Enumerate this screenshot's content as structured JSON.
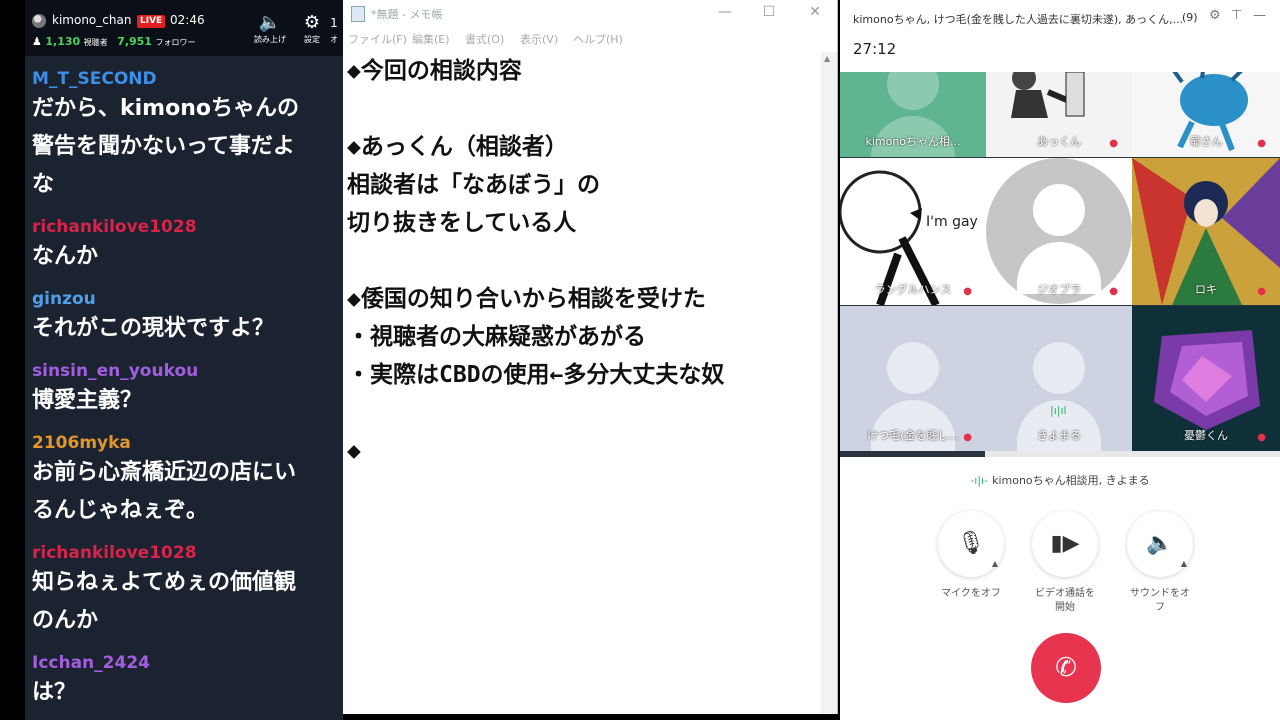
{
  "chat": {
    "header": {
      "username": "kimono_chan",
      "live_badge": "LIVE",
      "elapsed": "02:46",
      "viewers": "1,130",
      "viewers_label": "視聴者",
      "followers": "7,951",
      "followers_label": "フォロワー",
      "readaloud_label": "読み上げ",
      "settings_label": "設定",
      "extra_label": "オ"
    },
    "messages": [
      {
        "user": "M_T_SECOND",
        "color": "#3d8fe6",
        "lines": [
          "だから、kimonoちゃんの",
          "警告を聞かないって事だよ",
          "な"
        ]
      },
      {
        "user": "richankilove1028",
        "color": "#d8234a",
        "lines": [
          "なんか"
        ]
      },
      {
        "user": "ginzou",
        "color": "#4ea0e8",
        "lines": [
          "それがこの現状ですよ？"
        ]
      },
      {
        "user": "sinsin_en_youkou",
        "color": "#a35ee0",
        "lines": [
          "博愛主義？"
        ]
      },
      {
        "user": "2106myka",
        "color": "#e0962a",
        "lines": [
          "お前ら心斎橋近辺の店にい",
          "るんじゃねぇぞ。"
        ]
      },
      {
        "user": "richankilove1028",
        "color": "#d8234a",
        "lines": [
          "知らねぇよてめぇの価値観",
          "のんか"
        ]
      },
      {
        "user": "Icchan_2424",
        "color": "#a35ee0",
        "lines": [
          "は？"
        ]
      }
    ]
  },
  "notepad": {
    "title": "*無題 - メモ帳",
    "menu": [
      "ファイル(F)",
      "編集(E)",
      "書式(O)",
      "表示(V)",
      "ヘルプ(H)"
    ],
    "lines": [
      "◆今回の相談内容",
      "",
      "◆あっくん（相談者）",
      "相談者は「なあぼう」の",
      "切り抜きをしている人",
      "",
      "◆倭国の知り合いから相談を受けた",
      "・視聴者の大麻疑惑があがる",
      "・実際はCBDの使用←多分大丈夫な奴",
      "",
      "◆"
    ]
  },
  "call": {
    "title": "kimonoちゃん, けつ毛(金を賎した人過去に裏切未遂), あっくん,...",
    "count": "(9)",
    "timer": "27:12",
    "tiles": [
      {
        "name": "kimonoちゃん相..."
      },
      {
        "name": "あっくん"
      },
      {
        "name": "蜀さん"
      },
      {
        "name": "ラングルハンス",
        "overlay_text": "I'm gay"
      },
      {
        "name": "ジオプラ"
      },
      {
        "name": "ロキ"
      },
      {
        "name": "けつ毛(金を賎し..."
      },
      {
        "name": "きよまる"
      },
      {
        "name": "憂鬱くん"
      }
    ],
    "speaker": "kimonoちゃん相談用, きよまる",
    "controls": {
      "mic": "マイクをオフ",
      "video_1": "ビデオ通話を",
      "video_2": "開始",
      "sound": "サウンドをオフ"
    },
    "hangup_color": "#e8354f"
  }
}
